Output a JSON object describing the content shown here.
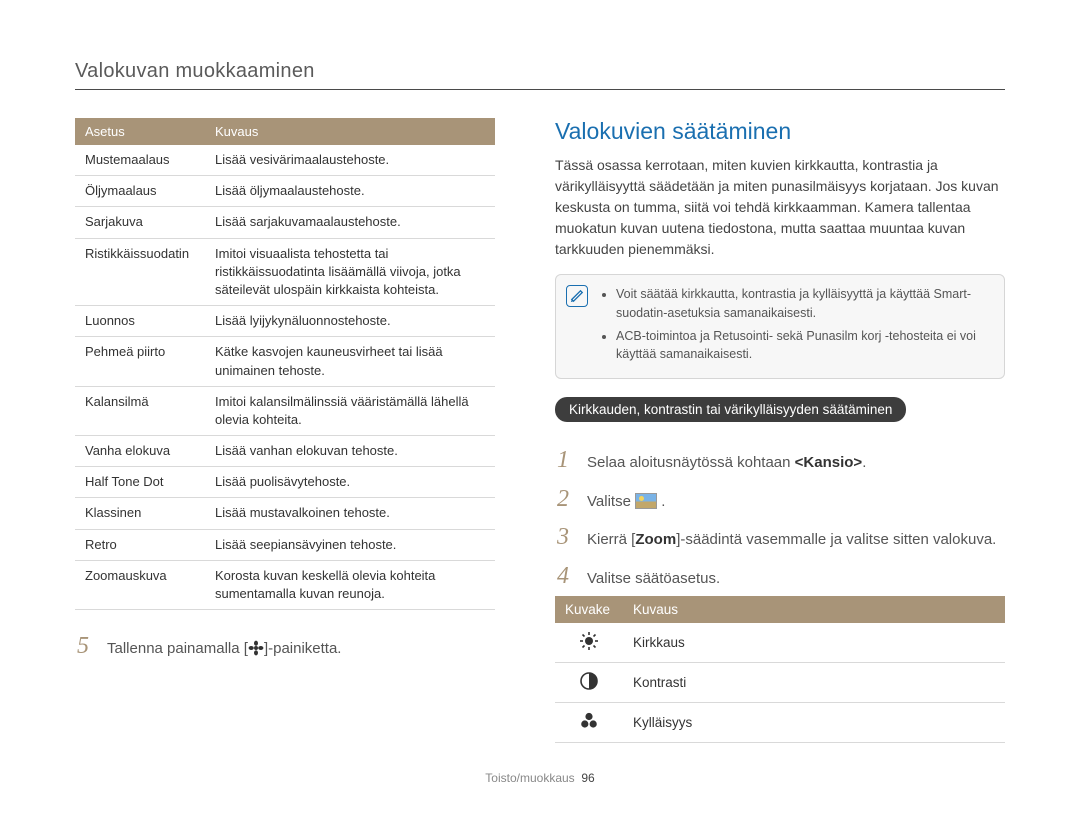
{
  "header": {
    "title": "Valokuvan muokkaaminen"
  },
  "effects_table": {
    "headers": [
      "Asetus",
      "Kuvaus"
    ],
    "rows": [
      [
        "Mustemaalaus",
        "Lisää vesivärimaalaustehoste."
      ],
      [
        "Öljymaalaus",
        "Lisää öljymaalaustehoste."
      ],
      [
        "Sarjakuva",
        "Lisää sarjakuvamaalaustehoste."
      ],
      [
        "Ristikkäissuodatin",
        "Imitoi visuaalista tehostetta tai ristikkäissuodatinta lisäämällä viivoja, jotka säteilevät ulospäin kirkkaista kohteista."
      ],
      [
        "Luonnos",
        "Lisää lyijykynäluonnostehoste."
      ],
      [
        "Pehmeä piirto",
        "Kätke kasvojen kauneusvirheet tai lisää unimainen tehoste."
      ],
      [
        "Kalansilmä",
        "Imitoi kalansilmälinssiä vääristämällä lähellä olevia kohteita."
      ],
      [
        "Vanha elokuva",
        "Lisää vanhan elokuvan tehoste."
      ],
      [
        "Half Tone Dot",
        "Lisää puolisävytehoste."
      ],
      [
        "Klassinen",
        "Lisää mustavalkoinen tehoste."
      ],
      [
        "Retro",
        "Lisää seepiansävyinen tehoste."
      ],
      [
        "Zoomauskuva",
        "Korosta kuvan keskellä olevia kohteita sumentamalla kuvan reunoja."
      ]
    ]
  },
  "left_step": {
    "num": "5",
    "text_before": "Tallenna painamalla [",
    "text_after": "]-painiketta."
  },
  "right": {
    "heading": "Valokuvien säätäminen",
    "intro": "Tässä osassa kerrotaan, miten kuvien kirkkautta, kontrastia ja värikylläisyyttä säädetään ja miten punasilmäisyys korjataan. Jos kuvan keskusta on tumma, siitä voi tehdä kirkkaamman. Kamera tallentaa muokatun kuvan uutena tiedostona, mutta saattaa muuntaa kuvan tarkkuuden pienemmäksi.",
    "notes": [
      "Voit säätää kirkkautta, kontrastia ja kylläisyyttä ja käyttää Smart-suodatin-asetuksia samanaikaisesti.",
      "ACB-toimintoa ja Retusointi- sekä Punasilm korj -tehosteita ei voi käyttää samanaikaisesti."
    ],
    "subhead": "Kirkkauden, kontrastin tai värikylläisyyden säätäminen",
    "steps": {
      "s1": {
        "num": "1",
        "before": "Selaa aloitusnäytössä kohtaan ",
        "bold": "<Kansio>",
        "after": "."
      },
      "s2": {
        "num": "2",
        "text": "Valitse "
      },
      "s3": {
        "num": "3",
        "before": "Kierrä [",
        "bold": "Zoom",
        "after": "]-säädintä vasemmalle ja valitse sitten valokuva."
      },
      "s4": {
        "num": "4",
        "text": "Valitse säätöasetus."
      }
    },
    "icon_table": {
      "headers": [
        "Kuvake",
        "Kuvaus"
      ],
      "rows": [
        {
          "icon": "brightness",
          "label": "Kirkkaus"
        },
        {
          "icon": "contrast",
          "label": "Kontrasti"
        },
        {
          "icon": "saturation",
          "label": "Kylläisyys"
        }
      ]
    }
  },
  "footer": {
    "section": "Toisto/muokkaus",
    "page": "96"
  }
}
